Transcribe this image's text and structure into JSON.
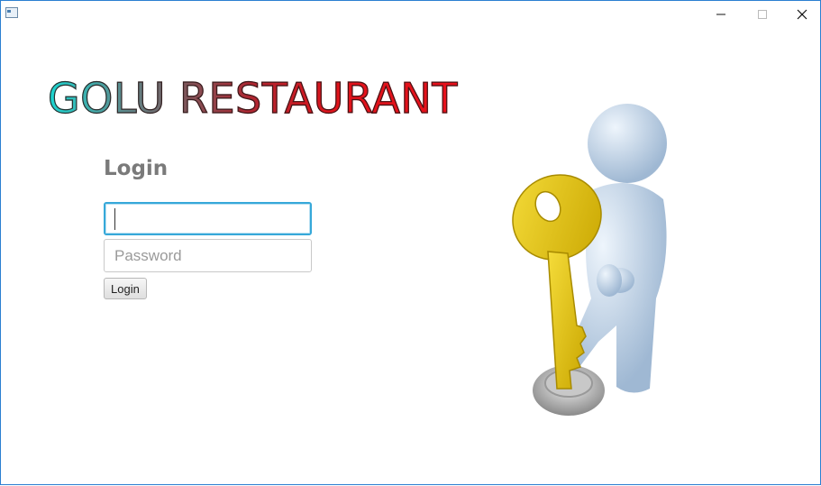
{
  "window": {
    "controls": [
      "minimize-icon",
      "maximize-icon",
      "close-icon"
    ]
  },
  "brand": {
    "title": "GOLU RESTAURANT",
    "colors": [
      "#1ad7d2",
      "#7a5a5e",
      "#e0131b"
    ]
  },
  "login": {
    "heading": "Login",
    "username_value": "",
    "password_placeholder": "Password",
    "button_label": "Login",
    "focus_color": "#36a8d9"
  },
  "illustration": {
    "icon": "person-with-key-icon",
    "key_color": "#e8c400",
    "figure_color": "#c9dcee"
  }
}
